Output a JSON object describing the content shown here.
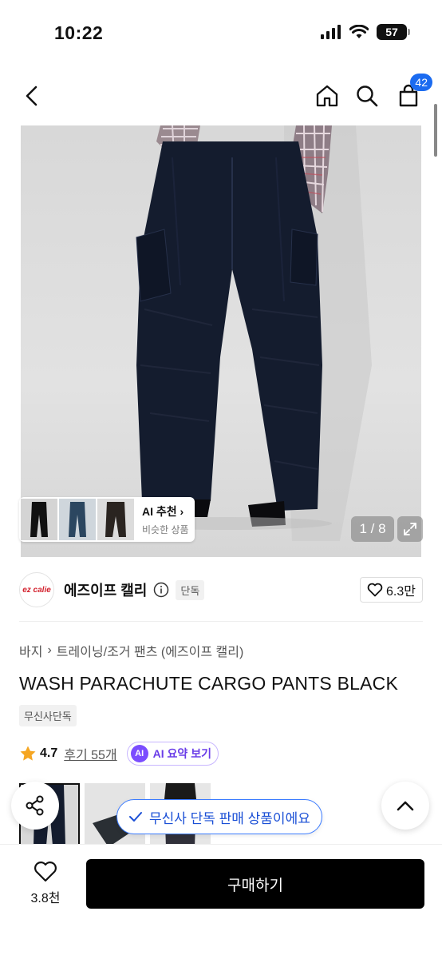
{
  "status_bar": {
    "time": "10:22",
    "battery": "57"
  },
  "header": {
    "cart_count": "42",
    "icons": [
      "back-icon",
      "home-icon",
      "search-icon",
      "cart-icon"
    ]
  },
  "hero": {
    "page_counter": "1 / 8",
    "ai_reco_title": "AI 추천",
    "ai_reco_sub": "비슷한 상품"
  },
  "brand": {
    "logo_text": "ez calie",
    "name": "에즈이프 캘리",
    "exclusive_tag": "단독",
    "like_count": "6.3만"
  },
  "product": {
    "breadcrumb": [
      "바지",
      "트레이닝/조거 팬츠 (에즈이프 캘리)"
    ],
    "title": "WASH PARACHUTE CARGO PANTS BLACK",
    "tag": "무신사단독",
    "rating": "4.7",
    "reviews": "후기 55개",
    "ai_chip": "AI",
    "ai_summary": "AI 요약 보기"
  },
  "toast": {
    "text": "무신사 단독 판매 상품이에요"
  },
  "bottom_bar": {
    "like_count": "3.8천",
    "buy_label": "구매하기"
  },
  "colors": {
    "accent": "#1b6bf0",
    "star": "#f5a623",
    "ai_purple": "#7b4dff"
  }
}
